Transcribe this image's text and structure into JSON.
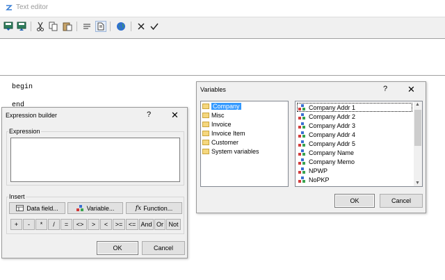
{
  "window": {
    "title": "Text editor"
  },
  "toolbar": {
    "buttons": [
      {
        "name": "save-down-button",
        "icon": "save-down-icon"
      },
      {
        "name": "save-up-button",
        "icon": "save-up-icon"
      },
      {
        "name": "cut-button",
        "icon": "scissors-icon"
      },
      {
        "name": "copy-button",
        "icon": "copy-icon"
      },
      {
        "name": "paste-button",
        "icon": "paste-icon"
      },
      {
        "name": "align-button",
        "icon": "text-lines-icon"
      },
      {
        "name": "page-button",
        "icon": "page-icon"
      },
      {
        "name": "globe-button",
        "icon": "globe-icon"
      },
      {
        "name": "cancel-button",
        "icon": "cross-icon"
      },
      {
        "name": "ok-button",
        "icon": "check-icon"
      }
    ]
  },
  "editor": {
    "lines": [
      "begin",
      "end"
    ]
  },
  "expression_builder": {
    "title": "Expression builder",
    "help": "?",
    "close": "✕",
    "expression_label": "Expression",
    "expression_value": "",
    "insert_label": "Insert",
    "data_field_label": "Data field...",
    "variable_label": "Variable...",
    "function_label": "Function...",
    "operators": [
      "+",
      "-",
      "*",
      "/",
      "=",
      "<>",
      ">",
      "<",
      ">=",
      "<=",
      "And",
      "Or",
      "Not"
    ],
    "ok_label": "OK",
    "cancel_label": "Cancel"
  },
  "variables": {
    "title": "Variables",
    "help": "?",
    "close": "✕",
    "categories": [
      "Company",
      "Misc",
      "Invoice",
      "Invoice Item",
      "Customer",
      "System variables"
    ],
    "selected_category": "Company",
    "items": [
      "Company Addr 1",
      "Company Addr 2",
      "Company Addr 3",
      "Company Addr 4",
      "Company Addr 5",
      "Company Name",
      "Company Memo",
      "NPWP",
      "NoPKP"
    ],
    "ok_label": "OK",
    "cancel_label": "Cancel"
  }
}
